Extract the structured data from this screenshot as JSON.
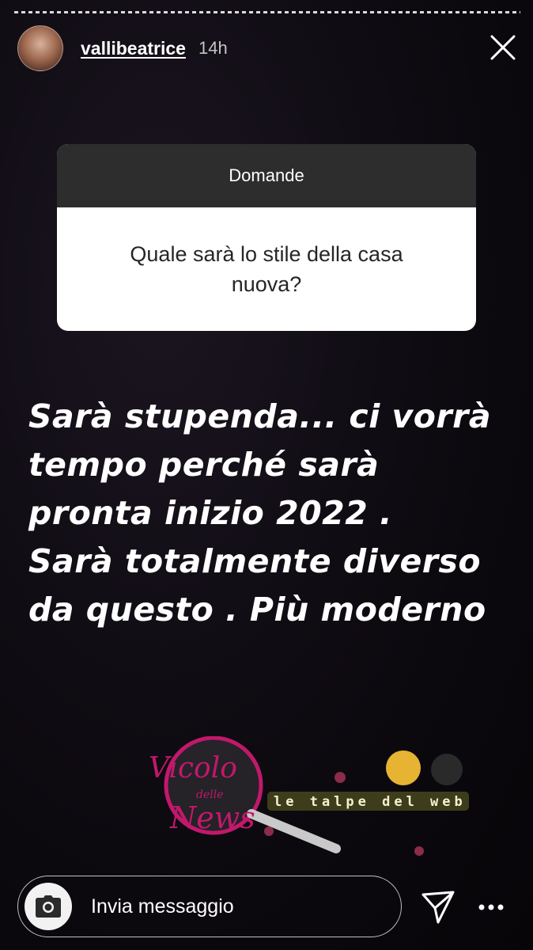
{
  "story": {
    "username": "vallibeatrice",
    "time": "14h"
  },
  "question_card": {
    "header": "Domande",
    "question": "Quale sarà lo stile della casa nuova?"
  },
  "answer_lines": [
    "Sarà stupenda... ci vorrà",
    "tempo perché sarà",
    "pronta inizio 2022 .",
    "Sarà totalmente diverso",
    "da questo . Più moderno"
  ],
  "watermark": {
    "brand_main": "Vicolo",
    "brand_small": "delle",
    "brand_tail": "News",
    "tagline": "le talpe del web"
  },
  "reply_bar": {
    "placeholder": "Invia messaggio"
  },
  "icons": {
    "close": "close-icon",
    "camera": "camera-icon",
    "send": "send-icon",
    "more": "more-icon"
  },
  "colors": {
    "card_header": "#2d2d2d",
    "card_body": "#ffffff",
    "watermark_accent": "#c2186b"
  }
}
